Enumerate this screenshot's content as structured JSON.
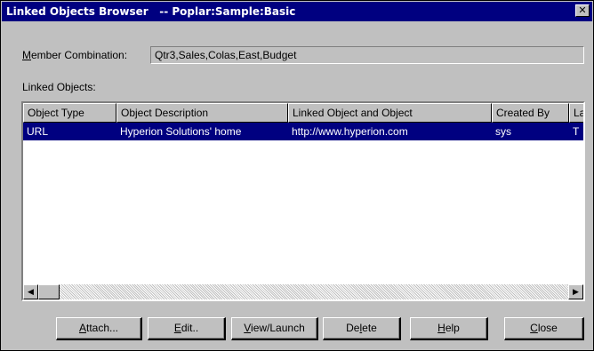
{
  "window": {
    "title": "Linked Objects Browser   -- Poplar:Sample:Basic",
    "close_glyph": "✕"
  },
  "member": {
    "label_hotkey": "M",
    "label_rest": "ember Combination:",
    "value": "Qtr3,Sales,Colas,East,Budget"
  },
  "linked_objects_label": "Linked Objects:",
  "table": {
    "columns": [
      "Object Type",
      "Object Description",
      "Linked Object and Object",
      "Created By",
      "La"
    ],
    "rows": [
      [
        "URL",
        "Hyperion Solutions' home",
        "http://www.hyperion.com",
        "sys",
        "T"
      ]
    ],
    "selected_row": 0
  },
  "scrollbar": {
    "left_arrow": "◀",
    "right_arrow": "▶"
  },
  "buttons": {
    "attach": {
      "hotkey": "A",
      "rest": "ttach..."
    },
    "edit": {
      "hotkey": "E",
      "rest": "dit.."
    },
    "view": {
      "hotkey": "V",
      "rest": "iew/Launch"
    },
    "delete": {
      "pre": "De",
      "hotkey": "l",
      "rest": "ete"
    },
    "help": {
      "hotkey": "H",
      "rest": "elp"
    },
    "close": {
      "hotkey": "C",
      "rest": "lose"
    }
  },
  "colors": {
    "title_bar": "#000080",
    "selection": "#000080",
    "dialog_bg": "#c0c0c0"
  }
}
